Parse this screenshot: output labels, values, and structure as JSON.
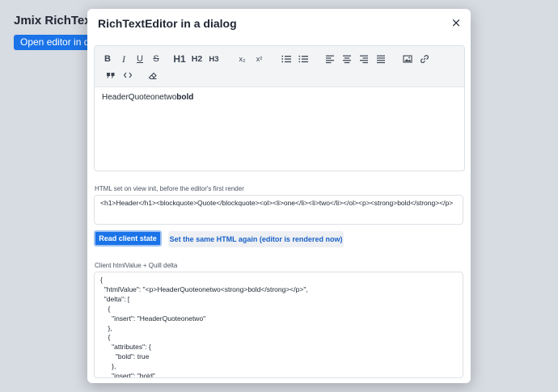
{
  "page": {
    "title": "Jmix RichTextEditor in a dialog",
    "open_button_label": "Open editor in dialog"
  },
  "dialog": {
    "title": "RichTextEditor in a dialog",
    "close_label": "×",
    "editor": {
      "toolbar": {
        "bold": "B",
        "italic": "I",
        "underline": "U",
        "strike": "S",
        "h1": "H1",
        "h2": "H2",
        "h3": "H3",
        "subscript": "x₂",
        "superscript": "x²"
      },
      "content": "HeaderQuoteonetwo",
      "content_bold": "bold"
    },
    "html_label": "HTML set on view init, before the editor's first render",
    "html_value": "<h1>Header</h1><blockquote>Quote</blockquote><ol><li>one</li><li>two</li></ol><p><strong>bold</strong></p>",
    "read_button_label": "Read client state",
    "set_html_button_label": "Set the same HTML again (editor is rendered now)",
    "client_label": "Client htmlValue + Quill delta",
    "client_value": "{\n  \"htmlValue\": \"<p>HeaderQuoteonetwo<strong>bold</strong></p>\",\n  \"delta\": [\n    {\n      \"insert\": \"HeaderQuoteonetwo\"\n    },\n    {\n      \"attributes\": {\n        \"bold\": true\n      },\n      \"insert\": \"bold\""
  }
}
